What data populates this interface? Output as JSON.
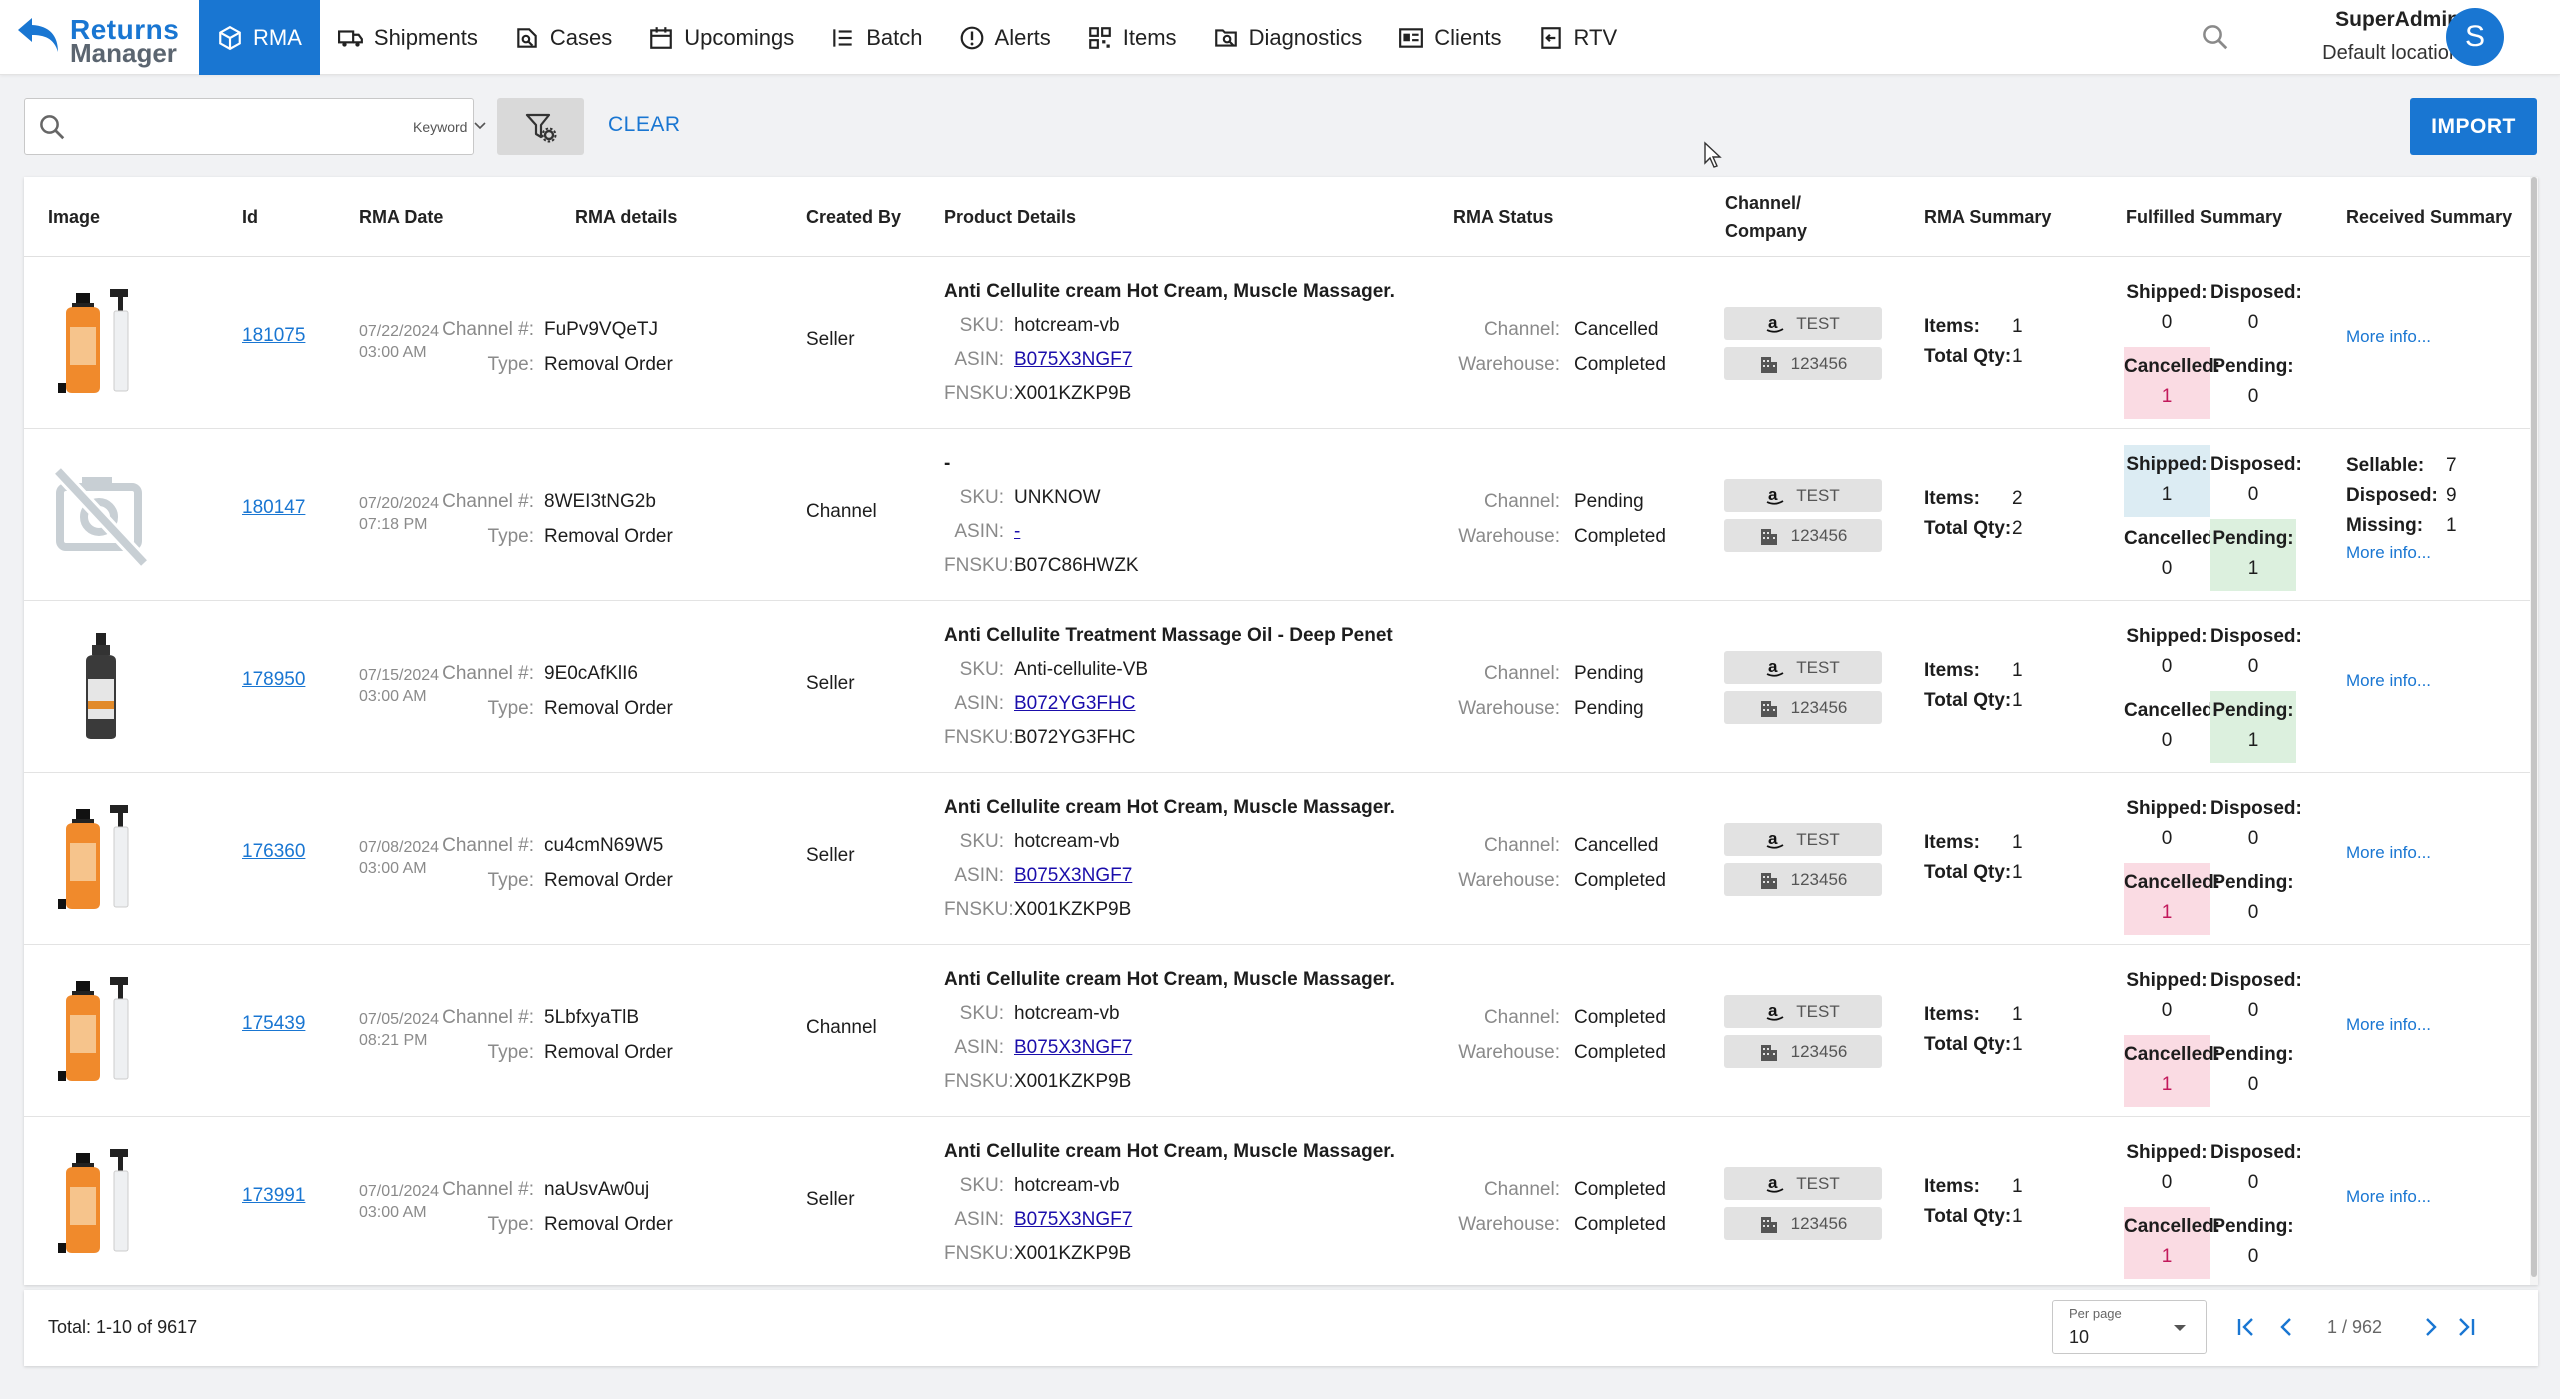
{
  "app": {
    "logo_line1": "Returns",
    "logo_line2": "Manager",
    "accent": "#1976d2"
  },
  "nav": [
    {
      "label": "RMA",
      "icon": "box-icon",
      "active": true
    },
    {
      "label": "Shipments",
      "icon": "truck-icon"
    },
    {
      "label": "Cases",
      "icon": "case-icon"
    },
    {
      "label": "Upcomings",
      "icon": "calendar-icon"
    },
    {
      "label": "Batch",
      "icon": "list-icon"
    },
    {
      "label": "Alerts",
      "icon": "alert-icon"
    },
    {
      "label": "Items",
      "icon": "qr-icon"
    },
    {
      "label": "Diagnostics",
      "icon": "diagnostics-icon"
    },
    {
      "label": "Clients",
      "icon": "id-card-icon"
    },
    {
      "label": "RTV",
      "icon": "rtv-icon"
    }
  ],
  "user": {
    "name": "SuperAdmin",
    "location": "Default location",
    "initial": "S"
  },
  "toolbar": {
    "search_value": "",
    "search_mode": "Keyword",
    "clear_label": "CLEAR",
    "import_label": "IMPORT"
  },
  "columns": [
    "Image",
    "Id",
    "RMA Date",
    "RMA details",
    "Created By",
    "Product Details",
    "RMA Status",
    "Channel/",
    "Company",
    "RMA Summary",
    "Fulfilled Summary",
    "Received Summary"
  ],
  "labels": {
    "channel_no": "Channel #:",
    "type": "Type:",
    "sku": "SKU:",
    "asin": "ASIN:",
    "fnsku": "FNSKU:",
    "status_channel": "Channel:",
    "status_warehouse": "Warehouse:",
    "items": "Items:",
    "total_qty": "Total Qty:",
    "shipped": "Shipped:",
    "disposed": "Disposed:",
    "cancelled": "Cancelled:",
    "cancelled_nocolon": "Cancelled",
    "pending": "Pending:",
    "more_info": "More info...",
    "sellable": "Sellable:",
    "missing": "Missing:"
  },
  "rows": [
    {
      "id": "181075",
      "date": "07/22/2024",
      "time": "03:00 AM",
      "image": "cream",
      "channel_no": "FuPv9VQeTJ",
      "type": "Removal Order",
      "created_by": "Seller",
      "title": "Anti Cellulite cream Hot Cream, Muscle Massager...",
      "sku": "hotcream-vb",
      "asin": "B075X3NGF7",
      "fnsku": "X001KZKP9B",
      "channel_status": "Cancelled",
      "warehouse_status": "Completed",
      "channel_tag": "TEST",
      "company": "123456",
      "items": "1",
      "total_qty": "1",
      "shipped": "0",
      "disposed": "0",
      "cancelled": "1",
      "pending": "0",
      "highlight": "cancelled"
    },
    {
      "id": "180147",
      "date": "07/20/2024",
      "time": "07:18 PM",
      "image": "none",
      "channel_no": "8WEI3tNG2b",
      "type": "Removal Order",
      "created_by": "Channel",
      "title": "-",
      "sku": "UNKNOW",
      "asin": "-",
      "fnsku": "B07C86HWZK",
      "channel_status": "Pending",
      "warehouse_status": "Completed",
      "channel_tag": "TEST",
      "company": "123456",
      "items": "2",
      "total_qty": "2",
      "shipped": "1",
      "disposed": "0",
      "cancelled": "0",
      "pending": "1",
      "highlight": "shipped-pending",
      "received": {
        "sellable": "7",
        "disposed": "9",
        "missing": "1"
      }
    },
    {
      "id": "178950",
      "date": "07/15/2024",
      "time": "03:00 AM",
      "image": "oil",
      "channel_no": "9E0cAfKlI6",
      "type": "Removal Order",
      "created_by": "Seller",
      "title": "Anti Cellulite Treatment Massage Oil - Deep Penet...",
      "sku": "Anti-cellulite-VB",
      "asin": "B072YG3FHC",
      "fnsku": "B072YG3FHC",
      "channel_status": "Pending",
      "warehouse_status": "Pending",
      "channel_tag": "TEST",
      "company": "123456",
      "items": "1",
      "total_qty": "1",
      "shipped": "0",
      "disposed": "0",
      "cancelled": "0",
      "pending": "1",
      "highlight": "pending"
    },
    {
      "id": "176360",
      "date": "07/08/2024",
      "time": "03:00 AM",
      "image": "cream",
      "channel_no": "cu4cmN69W5",
      "type": "Removal Order",
      "created_by": "Seller",
      "title": "Anti Cellulite cream Hot Cream, Muscle Massager...",
      "sku": "hotcream-vb",
      "asin": "B075X3NGF7",
      "fnsku": "X001KZKP9B",
      "channel_status": "Cancelled",
      "warehouse_status": "Completed",
      "channel_tag": "TEST",
      "company": "123456",
      "items": "1",
      "total_qty": "1",
      "shipped": "0",
      "disposed": "0",
      "cancelled": "1",
      "pending": "0",
      "highlight": "cancelled"
    },
    {
      "id": "175439",
      "date": "07/05/2024",
      "time": "08:21 PM",
      "image": "cream",
      "channel_no": "5LbfxyaTlB",
      "type": "Removal Order",
      "created_by": "Channel",
      "title": "Anti Cellulite cream Hot Cream, Muscle Massager...",
      "sku": "hotcream-vb",
      "asin": "B075X3NGF7",
      "fnsku": "X001KZKP9B",
      "channel_status": "Completed",
      "warehouse_status": "Completed",
      "channel_tag": "TEST",
      "company": "123456",
      "items": "1",
      "total_qty": "1",
      "shipped": "0",
      "disposed": "0",
      "cancelled": "1",
      "pending": "0",
      "highlight": "cancelled"
    },
    {
      "id": "173991",
      "date": "07/01/2024",
      "time": "03:00 AM",
      "image": "cream",
      "channel_no": "naUsvAw0uj",
      "type": "Removal Order",
      "created_by": "Seller",
      "title": "Anti Cellulite cream Hot Cream, Muscle Massager...",
      "sku": "hotcream-vb",
      "asin": "B075X3NGF7",
      "fnsku": "X001KZKP9B",
      "channel_status": "Completed",
      "warehouse_status": "Completed",
      "channel_tag": "TEST",
      "company": "123456",
      "items": "1",
      "total_qty": "1",
      "shipped": "0",
      "disposed": "0",
      "cancelled": "1",
      "pending": "0",
      "highlight": "cancelled"
    }
  ],
  "footer": {
    "total": "Total: 1-10 of 9617",
    "per_page_label": "Per page",
    "per_page_value": "10",
    "page": "1 / 962"
  }
}
